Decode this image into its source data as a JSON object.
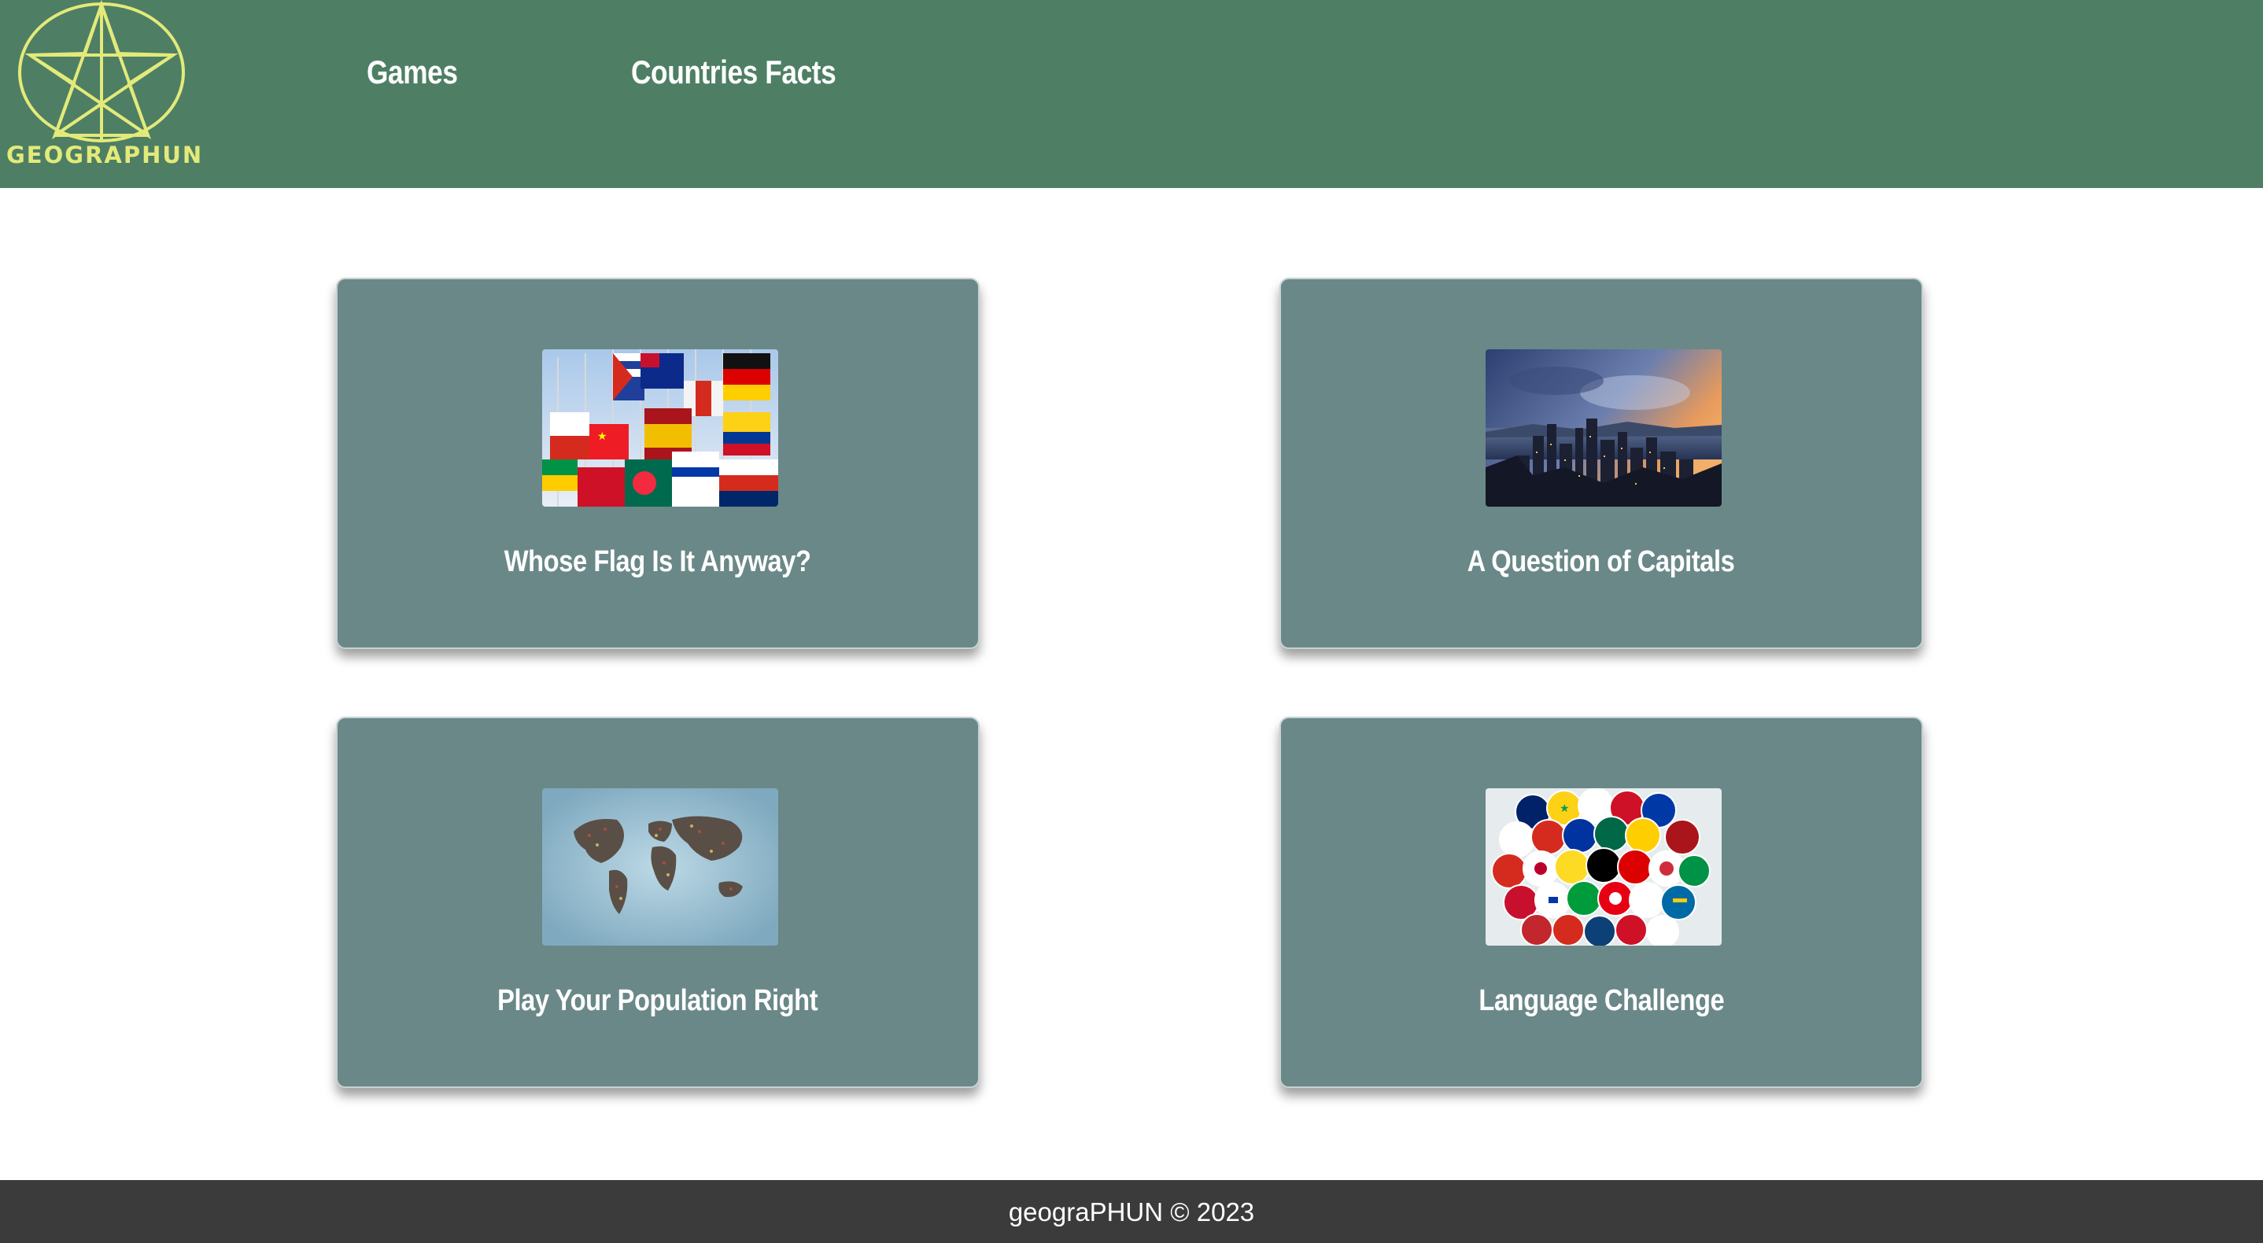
{
  "brand": {
    "logo_text": "GEOGRAPHUN",
    "logo_color": "#e3ea7a",
    "header_color": "#4e7f64"
  },
  "nav": {
    "games_label": "Games",
    "facts_label": "Countries Facts"
  },
  "cards": [
    {
      "title": "Whose Flag Is It Anyway?",
      "image": "flags-on-poles"
    },
    {
      "title": "A Question of Capitals",
      "image": "city-skyline-at-dusk"
    },
    {
      "title": "Play Your Population Right",
      "image": "world-map-of-people"
    },
    {
      "title": "Language Challenge",
      "image": "round-flag-icons-collage"
    }
  ],
  "card_color": "#6a8888",
  "footer": {
    "text": "geograPHUN © 2023",
    "color": "#3b3b3b"
  }
}
